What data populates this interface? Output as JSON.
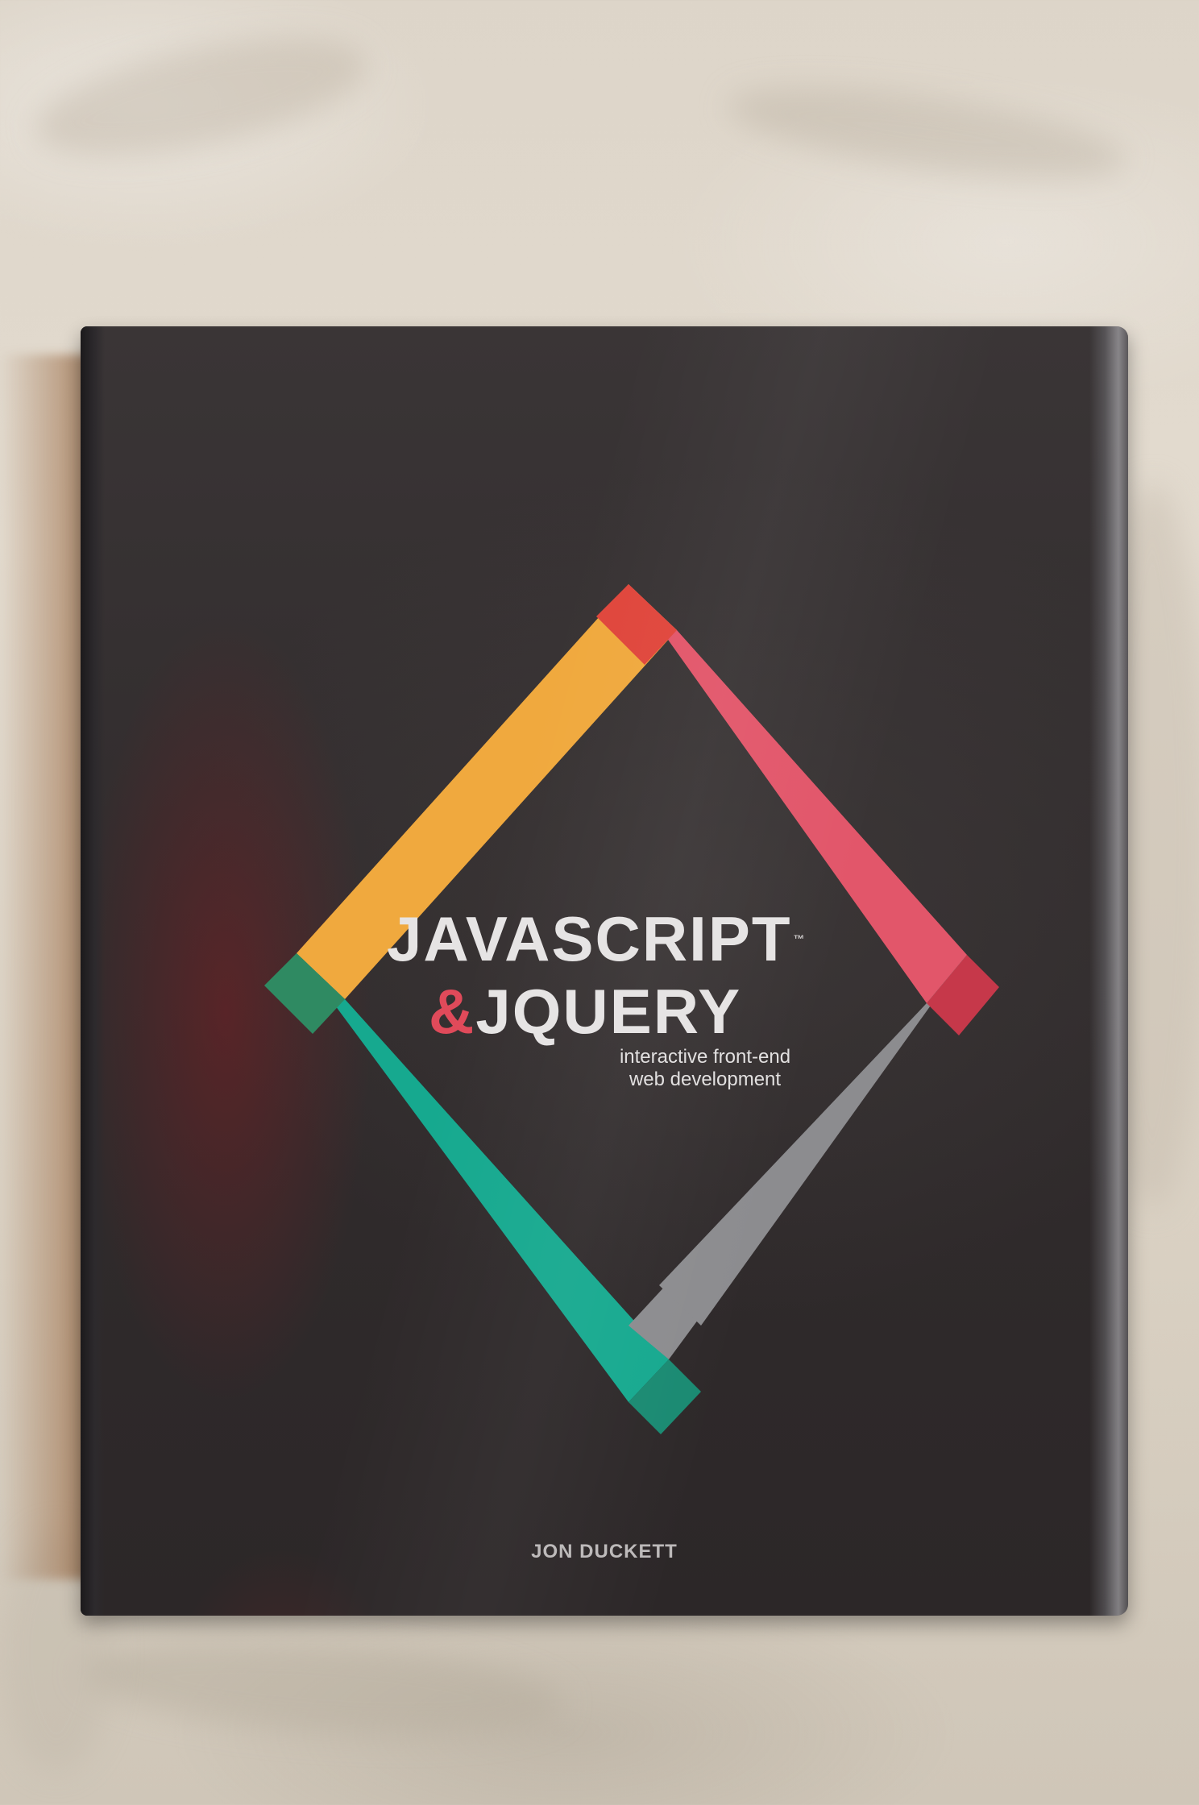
{
  "book": {
    "title_line1": "JAVASCRIPT",
    "trademark": "™",
    "ampersand": "&",
    "title_line2_rest": "JQUERY",
    "subtitle_line1": "interactive front-end",
    "subtitle_line2": "web development",
    "author": "JON DUCKETT"
  },
  "colors": {
    "cover": "#322d2e",
    "frame_orange": "#f0a93e",
    "frame_pink": "#e2566a",
    "frame_red_corner": "#e0463c",
    "frame_dark_red_corner": "#c6384a",
    "frame_teal": "#16a98f",
    "frame_dark_teal_corner": "#1a8a72",
    "frame_green_corner": "#2f8a62",
    "frame_gray": "#8a8a8c",
    "ampersand": "#e04a5a",
    "background_cloth": "#ddd5c9"
  }
}
